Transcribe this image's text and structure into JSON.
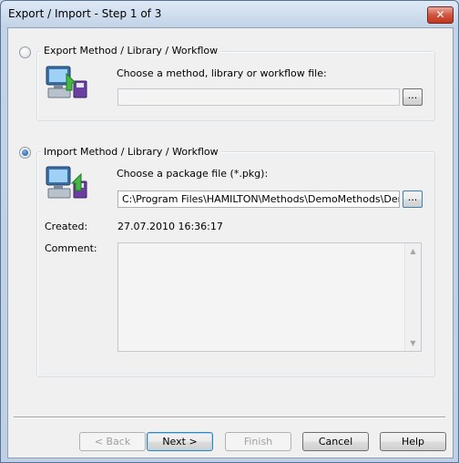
{
  "window": {
    "title": "Export / Import - Step 1 of 3",
    "close_glyph": "✕"
  },
  "export_section": {
    "label": "Export Method / Library / Workflow",
    "selected": false,
    "prompt": "Choose a method, library or workflow file:",
    "file_value": "",
    "browse_label": "..."
  },
  "import_section": {
    "label": "Import Method / Library / Workflow",
    "selected": true,
    "prompt": "Choose a package file (*.pkg):",
    "file_value": "C:\\Program Files\\HAMILTON\\Methods\\DemoMethods\\Demo_Dis",
    "browse_label": "...",
    "created_label": "Created:",
    "created_value": "27.07.2010 16:36:17",
    "comment_label": "Comment:",
    "comment_value": ""
  },
  "buttons": {
    "back": "< Back",
    "next": "Next >",
    "finish": "Finish",
    "cancel": "Cancel",
    "help": "Help"
  },
  "icons": {
    "export": "computer-export-icon",
    "import": "computer-import-icon",
    "scroll_up": "▲",
    "scroll_down": "▼"
  }
}
